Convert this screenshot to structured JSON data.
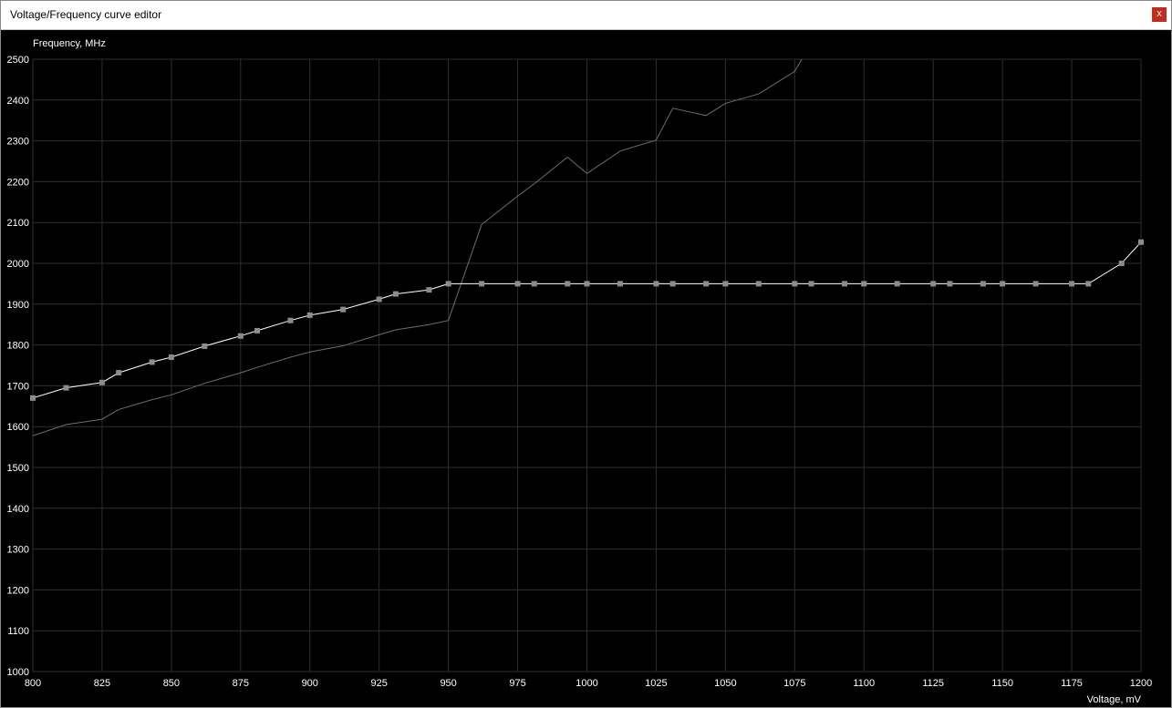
{
  "window": {
    "title": "Voltage/Frequency curve editor",
    "close_label": "x"
  },
  "colors": {
    "background": "#000000",
    "grid": "#2e2e2e",
    "curve": "#ffffff",
    "default_curve": "#6e6e6e",
    "point": "#8c8c8c",
    "label": "#ffffff"
  },
  "chart_data": {
    "type": "line",
    "xlabel": "Voltage, mV",
    "ylabel": "Frequency, MHz",
    "xlim": [
      800,
      1200
    ],
    "ylim": [
      1000,
      2500
    ],
    "grid": true,
    "xticks": [
      800,
      825,
      850,
      875,
      900,
      925,
      950,
      975,
      1000,
      1025,
      1050,
      1075,
      1100,
      1125,
      1150,
      1175,
      1200
    ],
    "yticks": [
      1000,
      1100,
      1200,
      1300,
      1400,
      1500,
      1600,
      1700,
      1800,
      1900,
      2000,
      2100,
      2200,
      2300,
      2400,
      2500
    ],
    "series": [
      {
        "role": "curve",
        "markers": true,
        "x": [
          800,
          812,
          825,
          831,
          843,
          850,
          862,
          875,
          881,
          893,
          900,
          912,
          925,
          931,
          943,
          950,
          962,
          975,
          981,
          993,
          1000,
          1012,
          1025,
          1031,
          1043,
          1050,
          1062,
          1075,
          1081,
          1093,
          1100,
          1112,
          1125,
          1131,
          1143,
          1150,
          1162,
          1175,
          1181,
          1193,
          1200
        ],
        "values": [
          1670,
          1695,
          1708,
          1732,
          1758,
          1770,
          1797,
          1822,
          1835,
          1860,
          1873,
          1887,
          1912,
          1925,
          1935,
          1950,
          1950,
          1950,
          1950,
          1950,
          1950,
          1950,
          1950,
          1950,
          1950,
          1950,
          1950,
          1950,
          1950,
          1950,
          1950,
          1950,
          1950,
          1950,
          1950,
          1950,
          1950,
          1950,
          1950,
          2000,
          2052
        ]
      },
      {
        "role": "default-curve",
        "markers": false,
        "x": [
          800,
          812,
          825,
          831,
          843,
          850,
          862,
          875,
          881,
          893,
          900,
          912,
          925,
          931,
          943,
          950,
          962,
          975,
          981,
          993,
          1000,
          1012,
          1025,
          1031,
          1043,
          1050,
          1062,
          1075,
          1078
        ],
        "values": [
          1578,
          1605,
          1618,
          1642,
          1666,
          1678,
          1706,
          1732,
          1745,
          1770,
          1783,
          1798,
          1825,
          1837,
          1850,
          1860,
          2095,
          2165,
          2195,
          2260,
          2220,
          2275,
          2302,
          2380,
          2362,
          2392,
          2415,
          2470,
          2505
        ]
      }
    ]
  }
}
